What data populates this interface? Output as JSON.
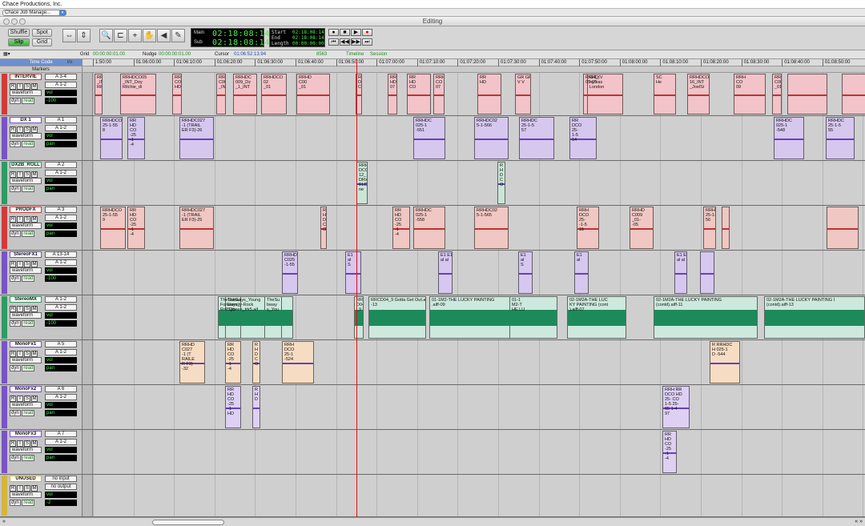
{
  "menubar": {
    "title": "Chace Productions, Inc."
  },
  "jobbar": {
    "selector_label": "Chace Job Manage..."
  },
  "window": {
    "title": "Editing"
  },
  "toolbar": {
    "modes": [
      "Shuffle",
      "Spot",
      "Slip",
      "Grid"
    ],
    "main_label": "Main",
    "sub_label": "Sub",
    "main_value": "02:18:08:14",
    "sub_value": "02:18:08:14",
    "start_label": "Start",
    "end_label": "End",
    "length_label": "Length",
    "start_value": "02:18:08:14",
    "end_value": "02:18:08:14",
    "length_value": "00:00:00:00"
  },
  "gridbar": {
    "grid_label": "Grid",
    "grid_value": "00:00:00:01.00",
    "nudge_label": "Nudge",
    "nudge_value": "00:00:00:01.00",
    "cursor_label": "Cursor",
    "cursor_value": "01:06:52:13.94",
    "count": "8563",
    "timeline": "Timeline",
    "session": "Session"
  },
  "rulers": {
    "timecode_label": "Time Code",
    "markers_label": "Markers",
    "io_header": "i/o",
    "ticks": [
      "1:50:00",
      "01:06:00:00",
      "01:06:10:00",
      "01:06:20:00",
      "01:06:30:00",
      "01:06:40:00",
      "01:06:50:00",
      "01:07:00:00",
      "01:07:10:00",
      "01:07:20:00",
      "01:07:30:00",
      "01:07:40:00",
      "01:07:50:00",
      "01:08:00:00",
      "01:08:10:00",
      "01:08:20:00",
      "01:08:30:00",
      "01:08:40:00",
      "01:08:50:00"
    ]
  },
  "tracks": [
    {
      "name": "INTERVIE",
      "input": "A 3-4",
      "output": "A 1-2",
      "view": "waveform",
      "vol": "vol",
      "pan": "-100",
      "pan2": "100",
      "color": "#d23a3a",
      "clipcolor": "#f2c3c8"
    },
    {
      "name": "DX 1",
      "input": "A 1",
      "output": "A 1-2",
      "view": "waveform",
      "vol": "vol",
      "pan": "pan",
      "color": "#7a52c7",
      "clipcolor": "#d6c7ef"
    },
    {
      "name": "DX2B_ROLL",
      "input": "A 2",
      "output": "A 1-2",
      "view": "waveform",
      "vol": "vol",
      "pan": "pan",
      "color": "#2e9b62",
      "clipcolor": "#c9e5d6"
    },
    {
      "name": "PRODFX",
      "input": "A 3",
      "output": "A 1-2",
      "view": "waveform",
      "vol": "vol",
      "pan": "pan",
      "color": "#d23a3a",
      "clipcolor": "#f0c7c2"
    },
    {
      "name": "StereoFX1",
      "input": "A 13-14",
      "output": "A 1-2",
      "view": "waveform",
      "vol": "vol",
      "pan": "-100",
      "pan2": "100",
      "color": "#7a52c7",
      "clipcolor": "#d6c7ef"
    },
    {
      "name": "StereoMX",
      "input": "A 1-2",
      "output": "A 1-2",
      "view": "waveform",
      "vol": "vol",
      "pan": "-100",
      "pan2": "100",
      "color": "#2e9b62",
      "clipcolor": "#cde8dc"
    },
    {
      "name": "MonoFx1",
      "input": "A 5",
      "output": "A 1-2",
      "view": "waveform",
      "vol": "vol",
      "pan": "pan",
      "color": "#7a52c7",
      "clipcolor": "#f5dcc3"
    },
    {
      "name": "MonoFx2",
      "input": "A 6",
      "output": "A 1-2",
      "view": "waveform",
      "vol": "vol",
      "pan": "pan",
      "color": "#7a52c7",
      "clipcolor": "#ddd0f2"
    },
    {
      "name": "MonoFx3",
      "input": "A 7",
      "output": "A 1-2",
      "view": "waveform",
      "vol": "vol",
      "pan": "pan",
      "color": "#7a52c7",
      "clipcolor": "#ddd0f2"
    },
    {
      "name": "UNUSED",
      "input": "no input",
      "output": "no output",
      "view": "waveform",
      "vol": "vol",
      "pan": "-2",
      "color": "#d5b63a",
      "clipcolor": "#e8e8e8"
    }
  ],
  "track_buttons": {
    "r": "R",
    "i": "I",
    "s": "S",
    "m": "M",
    "dyn": "dyn",
    "read": "read"
  },
  "clips": {
    "interview": [
      "RRHDCO05\n_INT_Doy\nRitchie_di",
      "RRHDCO05\n_INT_Doy\nRitchie_di",
      "RR\nCO\nHD",
      "RRHD\nC004\n_INT",
      "RRHDC\n009_Dz\n_1_INT",
      "RRHDCO\n02\n_01",
      "RRHD\nC00\n_01",
      "RRH\nD\nCO",
      "RRH\nHD\n07",
      "RR\nHD\nCO",
      "RRH\nCO\n07",
      "RR\nHD",
      "GR GR\nV V",
      "RRHDCO\n05-05",
      "GR_ V\nhy has\nLondon",
      "SC\nHe",
      "RRHDCO\n16_INT\n_JoelSi",
      "RRH\nCO\n09",
      "RRH\nC005\n_01"
    ],
    "dx1": [
      "RRHDCO\n25-1-55\n8",
      "RR\nHD\nCO\n-25\n-1\n-4",
      "RRHDC027\n-1 (TRAIL\nER F3)-26",
      "RRHDC\n025-1\n-551",
      "RRHDC02\n5-1-566",
      "RRHDC\n25-1-5\n57",
      "RR\nDCO\n25-\n1-5\n14",
      "RRHDC\n025-1\n-548",
      "RRHDC\n25-1-5\n55"
    ],
    "dx2b": [
      "RRH\nDCO\n12_\nDRx\nELD\nne",
      "R\nH\nD\nC\nO"
    ],
    "prodfx": [
      "RRHDCO\n25-1-55\n9",
      "RR\nHD\nCO\n-25\n-1\n-4",
      "RRHDC027\n-1 (TRAIL\nER F3)-25",
      "R\nH\nD\nC\nO",
      "RR\nHD\nCO\n-25\n-1\n-4",
      "RRHDC\n025-1\n-558",
      "RRHDC02\n5-1-565",
      "RRH\nDCO\n25-\n-1-5\n15",
      "RRHD\nC009\n_01-\n-05",
      "RRHDC\n25-1-5\n56"
    ],
    "stereofx1": [
      "RRHD\nC025\n-1-55",
      "E1\nal\nS",
      "E1 E1\nal al",
      "E1\nal\nS",
      "E1\nal",
      "E1 E1\nal al"
    ],
    "stereomx": [
      "TheSubways_Young\nForEternity-Rock\nRoll Queen_trk5.aif",
      "TheSub\nways_\nSub",
      "TheSu\nbway\ns_You",
      "RRC\nD04\n_9 0",
      "RRCD04_9 Gotta Get Out.aiff\n-13",
      "01-1M2-THE LUCKY PAINTING\n.aiff-09",
      "01-1\nM2-T\nHE LU",
      "02-1M2A-THE LUC\nKY PAINTING (cont\n).aiff-07",
      "02-1M2A-THE LUCKY PAINTING\n(contd).aiff-11",
      "02-1M2A-THE LUCKY PAINTING I\n(contd).aiff-13"
    ],
    "monofx1": [
      "RRHD\nC027\n-1 (T\nRAILE\nR F3)\n-32",
      "RR\nHD\nCO\n-25\n-1\n-4",
      "R\nH\nD\nC\nO",
      "RRH\nDCO\n25-1\n-524",
      "R RRHDC\nH 025-1\nD -544"
    ],
    "monofx2": [
      "RR\nHD\nCO\n-25\n-1\nHD",
      "R\nH\nD",
      "RRH RR\nDCO HD\n25- CO\n1-5 25-\n05 1-4\n97"
    ],
    "monofx3": [
      "RR\nHD\nCO\n-25\n-1\n-4"
    ]
  },
  "bottom": {
    "left": "»",
    "right": "« »"
  }
}
